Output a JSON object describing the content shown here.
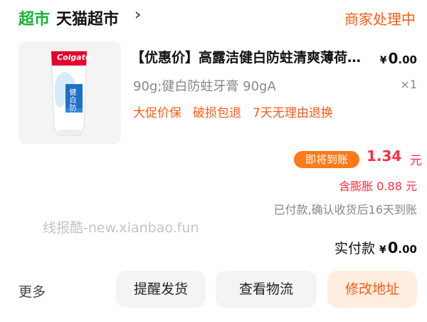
{
  "header": {
    "badge": "超市",
    "shop_name": "天猫超市",
    "status": "商家处理中"
  },
  "product": {
    "title": "【优惠价】高露洁健白防蛀清爽薄荷牙膏",
    "price_symbol": "¥",
    "price_int": "0",
    "price_dec": ".00",
    "spec": "90g;健白防蛀牙膏 90gA",
    "quantity": "×1",
    "tags": [
      "大促价保",
      "破损包退",
      "7天无理由退换"
    ],
    "thumb": {
      "brand": "Colgate",
      "name": "健白防蛀",
      "icon": "toothpaste-tube-icon",
      "brand_color": "#e4002b"
    }
  },
  "settlement": {
    "soon_badge": "即将到账",
    "amount": "1.34",
    "unit": "元",
    "inflate": "含膨胀 0.88 元",
    "paid_note": "已付款,确认收货后16天到账"
  },
  "watermark": "线报酷-new.xianbao.fun",
  "actual": {
    "label": "实付款",
    "symbol": "¥",
    "int": "0",
    "dec": ".00"
  },
  "footer": {
    "more": "更多",
    "remind": "提醒发货",
    "track": "查看物流",
    "edit_address": "修改地址"
  },
  "colors": {
    "brand_green": "#12b52f",
    "accent_orange": "#ff5a14",
    "accent_red": "#ff2e3d"
  }
}
